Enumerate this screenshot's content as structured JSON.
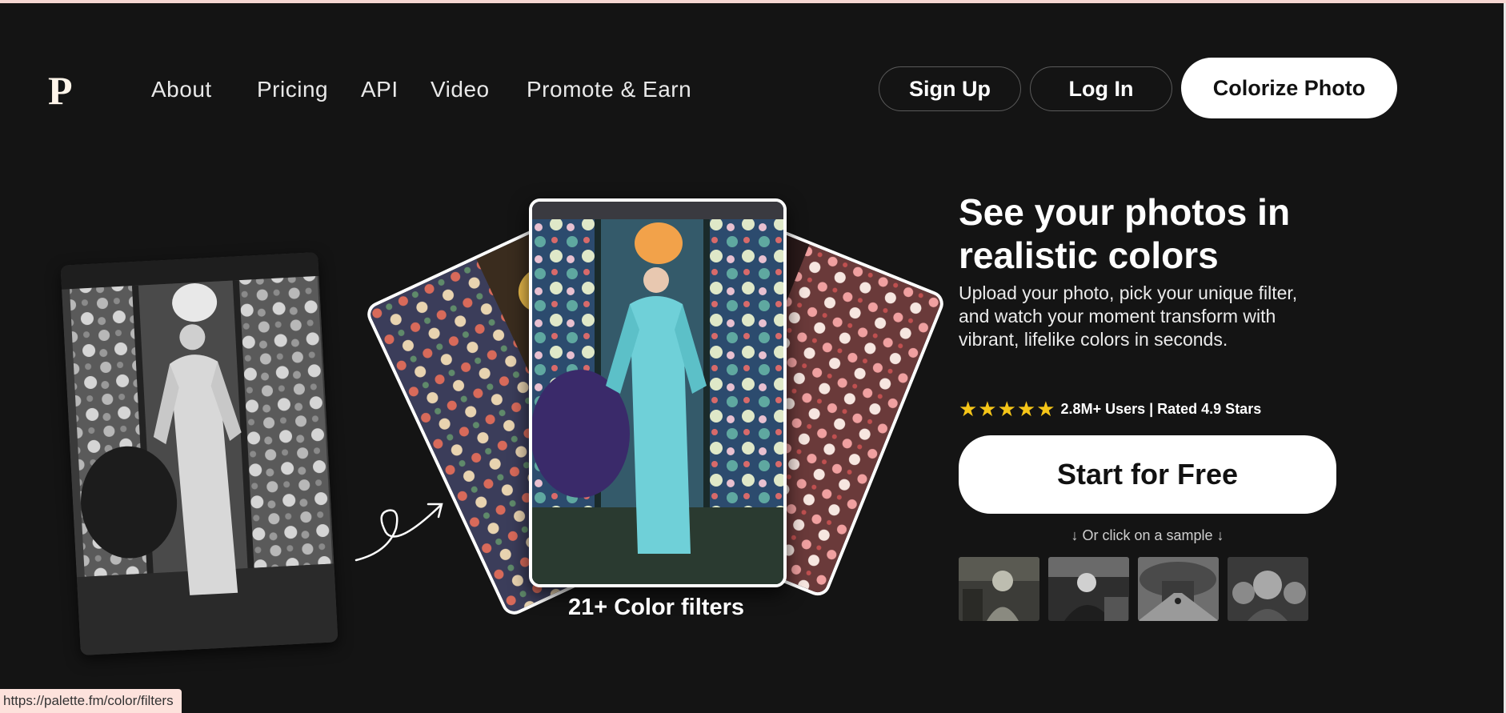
{
  "header": {
    "logo": "P",
    "nav": [
      "About",
      "Pricing",
      "API",
      "Video",
      "Promote & Earn"
    ],
    "sign_up": "Sign Up",
    "log_in": "Log In",
    "colorize": "Colorize Photo"
  },
  "hero": {
    "title": "See your photos in realistic colors",
    "description": "Upload your photo, pick your unique filter, and watch your moment transform with vibrant, lifelike colors in seconds.",
    "stars": "★★★★★",
    "rating_text": "2.8M+ Users | Rated 4.9 Stars",
    "cta": "Start for Free",
    "sample_hint": "↓ Or click on a sample ↓",
    "filters_caption": "21+ Color filters"
  },
  "status_bar": {
    "url": "https://palette.fm/color/filters"
  },
  "colors": {
    "background": "#141414",
    "star": "#f5c518",
    "accent_white": "#ffffff"
  }
}
